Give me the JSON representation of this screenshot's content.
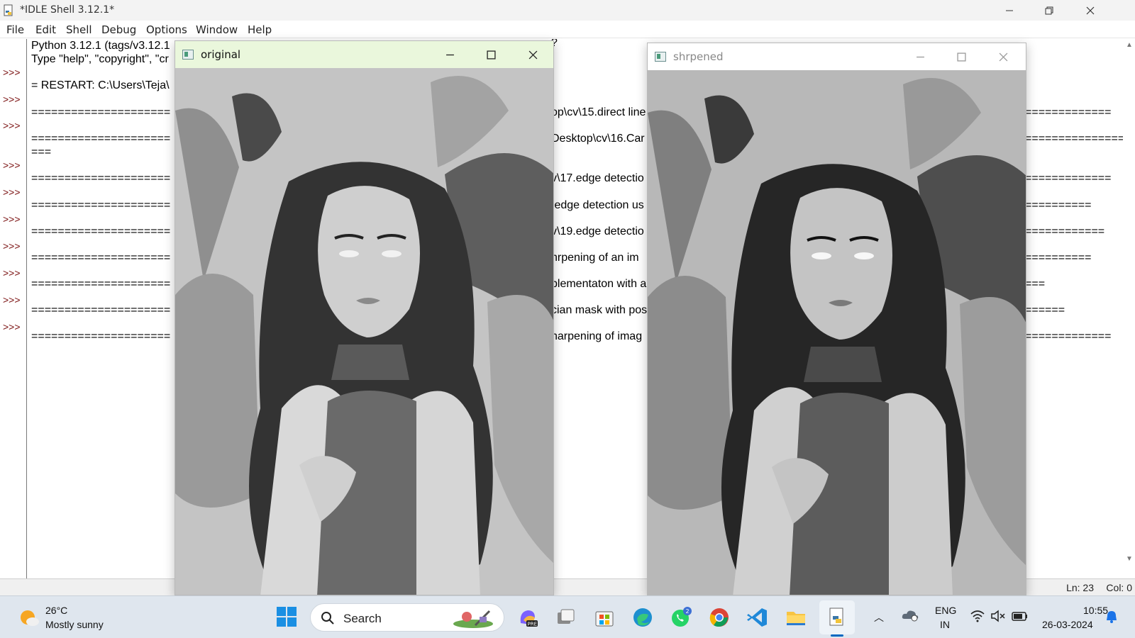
{
  "idle": {
    "title": "*IDLE Shell 3.12.1*",
    "menu": [
      "File",
      "Edit",
      "Shell",
      "Debug",
      "Options",
      "Window",
      "Help"
    ],
    "prompts": [
      ">>>",
      ">>>",
      ">>>",
      ">>>",
      ">>>",
      ">>>",
      ">>>",
      ">>>",
      ">>>",
      ">>>"
    ],
    "lines_left": [
      "Python 3.12.1 (tags/v3.12.1",
      "Type \"help\", \"copyright\", \"cr",
      "= RESTART: C:\\Users\\Teja\\",
      "=====================",
      "=====================",
      "===",
      "=====================",
      "=====================",
      "=====================",
      "=====================",
      "=====================",
      "=====================",
      "====================="
    ],
    "lines_mid": [
      "?",
      "op\\cv\\15.direct line",
      "Desktop\\cv\\16.Car",
      "v\\17.edge detectio",
      ".edge detection us",
      "v\\19.edge detectio",
      "hrpening of an im",
      "plementaton with a",
      "cian mask with pos",
      "harpening of imag"
    ],
    "lines_right": [
      "=============",
      "===============",
      "=============",
      "==========",
      "============",
      "==========",
      "===",
      "======",
      "============="
    ],
    "status": {
      "ln": "Ln: 23",
      "col": "Col: 0"
    }
  },
  "windows": {
    "original": {
      "title": "original"
    },
    "sharpened": {
      "title": "shrpened"
    }
  },
  "taskbar": {
    "weather": {
      "temp": "26°C",
      "desc": "Mostly sunny"
    },
    "search_label": "Search",
    "apps": [
      "copilot-icon",
      "task-view-icon",
      "microsoft-store-icon",
      "edge-icon",
      "whatsapp-icon",
      "chrome-icon",
      "vscode-icon",
      "file-explorer-icon",
      "idle-python-icon"
    ],
    "whatsapp_badge": "2",
    "lang_line1": "ENG",
    "lang_line2": "IN",
    "time": "10:55",
    "date": "26-03-2024"
  },
  "colors": {
    "prompt": "#7a1010",
    "active_titlebar": "#eaf7dc",
    "taskbar": "#dfe6ee"
  }
}
